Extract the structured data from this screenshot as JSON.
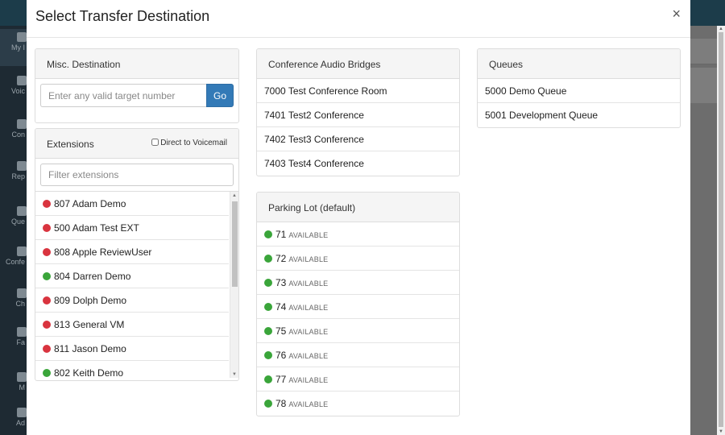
{
  "modal": {
    "title": "Select Transfer Destination",
    "close_label": "×"
  },
  "misc": {
    "heading": "Misc. Destination",
    "placeholder": "Enter any valid target number",
    "go_label": "Go"
  },
  "extensions": {
    "heading": "Extensions",
    "voicemail_label": "Direct to Voicemail",
    "filter_placeholder": "Filter extensions",
    "items": [
      {
        "label": "807 Adam Demo",
        "status": "red"
      },
      {
        "label": "500 Adam Test EXT",
        "status": "red"
      },
      {
        "label": "808 Apple ReviewUser",
        "status": "red"
      },
      {
        "label": "804 Darren Demo",
        "status": "green"
      },
      {
        "label": "809 Dolph Demo",
        "status": "red"
      },
      {
        "label": "813 General VM",
        "status": "red"
      },
      {
        "label": "811 Jason Demo",
        "status": "red"
      },
      {
        "label": "802 Keith Demo",
        "status": "green"
      }
    ]
  },
  "conference": {
    "heading": "Conference Audio Bridges",
    "items": [
      "7000 Test Conference Room",
      "7401 Test2 Conference",
      "7402 Test3 Conference",
      "7403 Test4 Conference"
    ]
  },
  "parking": {
    "heading": "Parking Lot (default)",
    "status_label": "AVAILABLE",
    "items": [
      "71",
      "72",
      "73",
      "74",
      "75",
      "76",
      "77",
      "78"
    ]
  },
  "queues": {
    "heading": "Queues",
    "items": [
      "5000 Demo Queue",
      "5001 Development Queue"
    ]
  },
  "colors": {
    "available": "#3aa53a",
    "busy": "#d9343f",
    "primary": "#337ab7"
  }
}
